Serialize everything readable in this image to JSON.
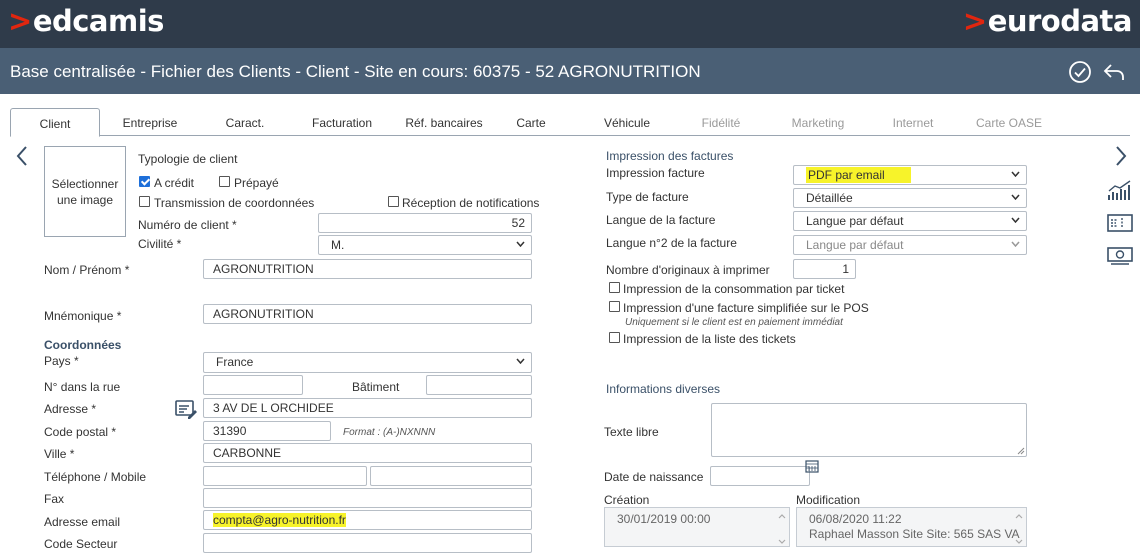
{
  "header": {
    "logo_left": "edcamis",
    "logo_right": "eurodata",
    "title": "Base centralisée - Fichier des Clients - Client - Site en cours: 60375 - 52 AGRONUTRITION"
  },
  "tabs": [
    {
      "label": "Client",
      "state": "active"
    },
    {
      "label": "Entreprise",
      "state": "enabled"
    },
    {
      "label": "Caract.",
      "state": "enabled"
    },
    {
      "label": "Facturation",
      "state": "enabled"
    },
    {
      "label": "Réf. bancaires",
      "state": "enabled"
    },
    {
      "label": "Carte",
      "state": "enabled"
    },
    {
      "label": "Véhicule",
      "state": "enabled"
    },
    {
      "label": "Fidélité",
      "state": "disabled"
    },
    {
      "label": "Marketing",
      "state": "disabled"
    },
    {
      "label": "Internet",
      "state": "disabled"
    },
    {
      "label": "Carte OASE",
      "state": "disabled"
    }
  ],
  "client": {
    "photo_label": "Sélectionner une image",
    "typology_label": "Typologie de client",
    "credit_label": "A crédit",
    "credit_checked": true,
    "prepaid_label": "Prépayé",
    "prepaid_checked": false,
    "transmission_label": "Transmission de coordonnées",
    "notifications_label": "Réception de notifications",
    "client_number_label": "Numéro de client *",
    "client_number": "52",
    "civility_label": "Civilité *",
    "civility": "M.",
    "name_label": "Nom / Prénom *",
    "name": "AGRONUTRITION",
    "mnemonic_label": "Mnémonique *",
    "mnemonic": "AGRONUTRITION"
  },
  "coordinates": {
    "section": "Coordonnées",
    "country_label": "Pays *",
    "country": "France",
    "street_no_label": "N° dans la rue",
    "building_label": "Bâtiment",
    "address_label": "Adresse *",
    "address": "3 AV DE L ORCHIDEE",
    "postal_label": "Code postal *",
    "postal": "31390",
    "postal_hint": "Format : (A-)NXNNN",
    "city_label": "Ville *",
    "city": "CARBONNE",
    "phone_label": "Téléphone / Mobile",
    "fax_label": "Fax",
    "email_label": "Adresse email",
    "email": "compta@agro-nutrition.fr",
    "sector_label": "Code Secteur"
  },
  "invoice_print": {
    "section": "Impression des factures",
    "print_label": "Impression facture",
    "print_value": "PDF par email",
    "type_label": "Type de facture",
    "type_value": "Détaillée",
    "lang_label": "Langue de la facture",
    "lang_value": "Langue par défaut",
    "lang2_label": "Langue n°2 de la facture",
    "lang2_value": "Langue par défaut",
    "originals_label": "Nombre d'originaux à imprimer",
    "originals_value": "1",
    "consumption_label": "Impression de la consommation par ticket",
    "simplified_label": "Impression d'une facture simplifiée sur le POS",
    "simplified_hint": "Uniquement si le client est en paiement immédiat",
    "tickets_label": "Impression de la liste des tickets"
  },
  "misc": {
    "section": "Informations diverses",
    "free_text_label": "Texte libre",
    "birth_label": "Date de naissance",
    "creation_label": "Création",
    "creation_value": "30/01/2019 00:00",
    "modification_label": "Modification",
    "modification_date": "06/08/2020 11:22",
    "modification_user": "Raphael Masson Site Site: 565 SAS VA"
  },
  "colors": {
    "topbar": "#2f3b4a",
    "titlebar": "#4a5f75",
    "brand_red": "#e1260f",
    "highlight": "#f7f32a",
    "section": "#3a5068"
  }
}
